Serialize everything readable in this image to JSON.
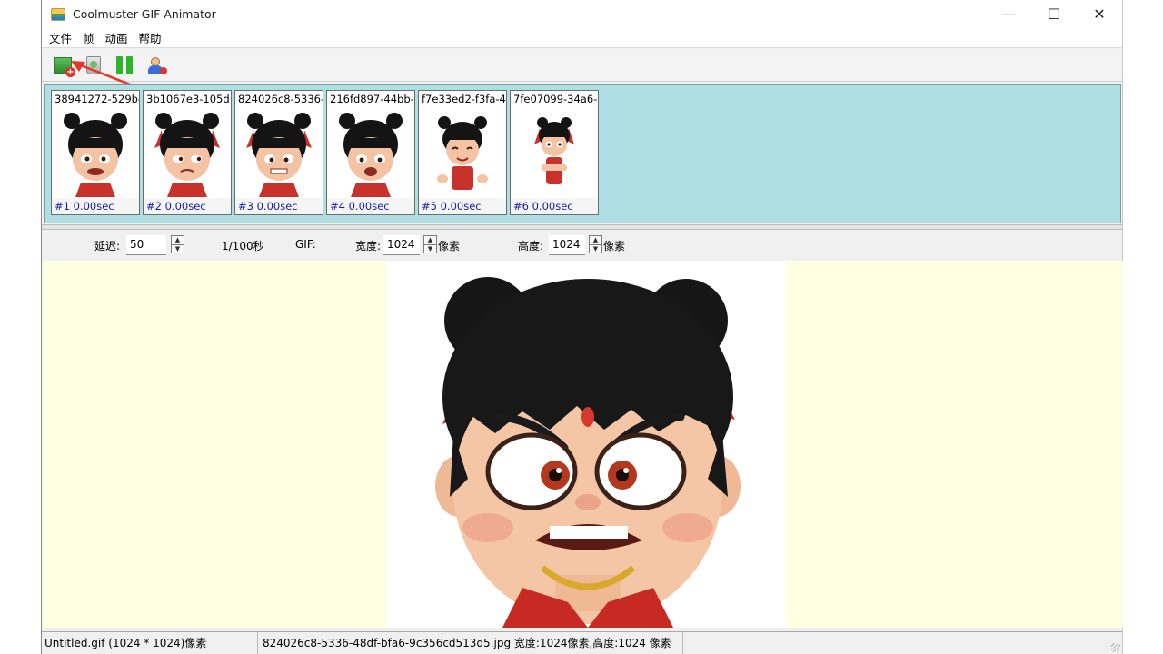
{
  "window": {
    "title": "Coolmuster GIF Animator",
    "controls": {
      "minimize": "—",
      "maximize": "☐",
      "close": "✕"
    }
  },
  "menu": [
    {
      "label": "文件"
    },
    {
      "label": "帧"
    },
    {
      "label": "动画"
    },
    {
      "label": "帮助"
    }
  ],
  "toolbar": {
    "icons": [
      "add-frame-icon",
      "delete-frame-icon",
      "pause-icon",
      "about-icon"
    ]
  },
  "frames": [
    {
      "name": "38941272-529b-",
      "footer": "#1 0.00sec"
    },
    {
      "name": "3b1067e3-105d",
      "footer": "#2 0.00sec"
    },
    {
      "name": "824026c8-5336-",
      "footer": "#3 0.00sec"
    },
    {
      "name": "216fd897-44bb-",
      "footer": "#4 0.00sec"
    },
    {
      "name": "f7e33ed2-f3fa-4",
      "footer": "#5 0.00sec"
    },
    {
      "name": "7fe07099-34a6-",
      "footer": "#6 0.00sec"
    }
  ],
  "properties": {
    "delay_label": "延迟:",
    "delay_value": "50",
    "delay_unit": "1/100秒",
    "gif_label": "GIF:",
    "width_label": "宽度:",
    "width_value": "1024",
    "width_unit": "像素",
    "height_label": "高度:",
    "height_value": "1024",
    "height_unit": "像素"
  },
  "status": {
    "file_info": "Untitled.gif (1024 * 1024)像素",
    "frame_info": "824026c8-5336-48df-bfa6-9c356cd513d5.jpg 宽度:1024像素,高度:1024 像素"
  },
  "colors": {
    "frames_background": "#afdfe3",
    "preview_background": "#ffffe1",
    "annotation_arrow": "#e8352a"
  }
}
